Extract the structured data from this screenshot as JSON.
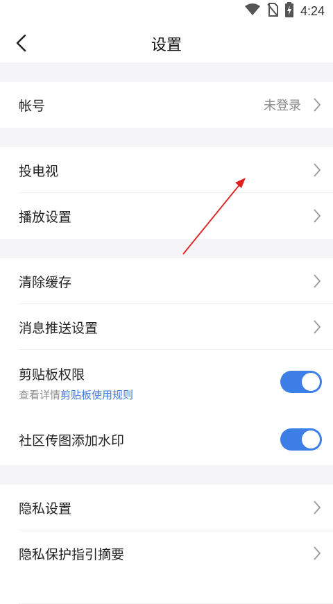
{
  "status_bar": {
    "time": "4:24",
    "icons": [
      "wifi-icon",
      "no-sim-icon",
      "battery-charging-icon"
    ]
  },
  "header": {
    "title": "设置",
    "back_icon": "chevron-left-icon"
  },
  "groups": {
    "account": {
      "label": "帐号",
      "value": "未登录"
    },
    "cast": {
      "label": "投电视"
    },
    "playback": {
      "label": "播放设置"
    },
    "clear_cache": {
      "label": "清除缓存"
    },
    "push": {
      "label": "消息推送设置"
    },
    "clipboard": {
      "label": "剪贴板权限",
      "sub_prefix": "查看详情",
      "sub_link": "剪贴板使用规则",
      "enabled": true
    },
    "watermark": {
      "label": "社区传图添加水印",
      "enabled": true
    },
    "privacy": {
      "label": "隐私设置"
    },
    "privacy_summary": {
      "label": "隐私保护指引摘要"
    }
  },
  "colors": {
    "accent": "#3d7fe6",
    "link": "#3b78e7",
    "annotation_arrow": "#e02020"
  }
}
